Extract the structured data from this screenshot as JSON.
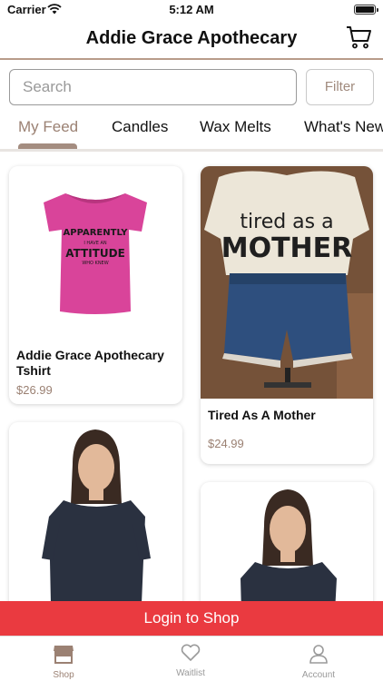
{
  "status_bar": {
    "carrier": "Carrier",
    "time": "5:12 AM"
  },
  "nav": {
    "title": "Addie Grace Apothecary"
  },
  "search": {
    "placeholder": "Search",
    "filter_label": "Filter"
  },
  "tabs": [
    {
      "label": "My Feed",
      "active": true
    },
    {
      "label": "Candles",
      "active": false
    },
    {
      "label": "Wax Melts",
      "active": false
    },
    {
      "label": "What's New",
      "active": false
    }
  ],
  "products": [
    {
      "name": "Addie Grace Apothecary Tshirt",
      "price": "$26.99",
      "shirt_text": "APPARENTLY I HAVE AN ATTITUDE WHO KNEW"
    },
    {
      "name": "Tired As A Mother",
      "price": "$24.99",
      "shirt_text": "tired as a MOTHER"
    },
    {
      "name": "",
      "price": ""
    },
    {
      "name": "",
      "price": ""
    }
  ],
  "login_banner": {
    "label": "Login to Shop"
  },
  "tab_bar": [
    {
      "label": "Shop",
      "icon": "shop-icon",
      "active": true
    },
    {
      "label": "Waitlist",
      "icon": "heart-icon",
      "active": false
    },
    {
      "label": "Account",
      "icon": "person-icon",
      "active": false
    }
  ],
  "colors": {
    "accent": "#9b8173",
    "login": "#ea3a40",
    "divider": "#b89c8a"
  }
}
